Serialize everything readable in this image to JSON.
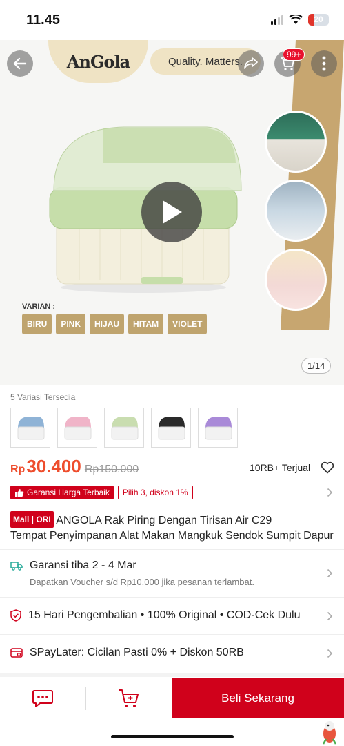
{
  "status": {
    "time": "11.45",
    "battery": "20"
  },
  "hero": {
    "brand": "AnGola",
    "tagline": "Quality. Matters.",
    "cart_count": "99+",
    "varian_title": "VARIAN :",
    "varian_chips": [
      "BIRU",
      "PINK",
      "HIJAU",
      "HITAM",
      "VIOLET"
    ],
    "counter": "1/14"
  },
  "variations": {
    "label": "5 Variasi Tersedia",
    "colors": [
      "#8fb3d6",
      "#f0b4c8",
      "#c9ddb0",
      "#2a2a2a",
      "#a98ad8"
    ]
  },
  "price": {
    "currency": "Rp",
    "value": "30.400",
    "original": "Rp150.000",
    "sold": "10RB+ Terjual"
  },
  "badges": {
    "guarantee": "Garansi Harga Terbaik",
    "promo": "Pilih 3, diskon 1%"
  },
  "product": {
    "mall_badge": "Mall | ORI",
    "title_line1": "ANGOLA Rak Piring Dengan Tirisan Air C29",
    "title_line2": "Tempat Penyimpanan Alat Makan Mangkuk Sendok Sumpit Dapur"
  },
  "shipping": {
    "title": "Garansi tiba 2 - 4 Mar",
    "subtitle": "Dapatkan Voucher s/d Rp10.000 jika pesanan terlambat."
  },
  "assurance": {
    "text": "15 Hari Pengembalian  •  100% Original  •  COD-Cek Dulu"
  },
  "paylater": {
    "text": "SPayLater: Cicilan Pasti 0% + Diskon 50RB"
  },
  "bottom": {
    "buy_label": "Beli Sekarang"
  },
  "colors": {
    "accent": "#d0011b",
    "price": "#ee4d2d"
  }
}
